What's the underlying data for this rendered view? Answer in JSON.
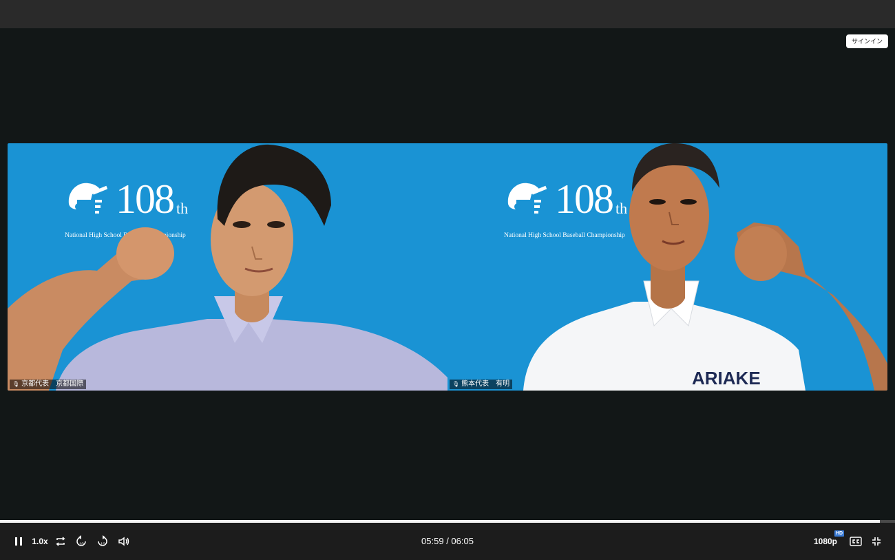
{
  "header": {
    "signin_label": "サインイン"
  },
  "tiles": [
    {
      "logo_number": "108",
      "logo_ordinal": "th",
      "logo_subtitle": "National High School Baseball Championship",
      "participant_label": "京都代表　京都国際",
      "shirt_text": ""
    },
    {
      "logo_number": "108",
      "logo_ordinal": "th",
      "logo_subtitle": "National High School Baseball Championship",
      "participant_label": "熊本代表　有明",
      "shirt_text": "ARIAKE"
    }
  ],
  "player": {
    "progress_fraction": 0.983,
    "speed": "1.0x",
    "time": "05:59 / 06:05",
    "quality": "1080p",
    "quality_badge": "HD",
    "rewind_seconds": "10",
    "forward_seconds": "10"
  },
  "colors": {
    "tile_bg": "#1a93d4",
    "page_bg": "#121717",
    "controls_bg": "#1c1c1c",
    "hd_badge": "#3a7bd5"
  },
  "icons": [
    "pause-icon",
    "loop-icon",
    "rewind-10-icon",
    "forward-10-icon",
    "volume-icon",
    "captions-icon",
    "exit-fullscreen-icon",
    "microphone-icon",
    "helmet-logo-icon"
  ]
}
